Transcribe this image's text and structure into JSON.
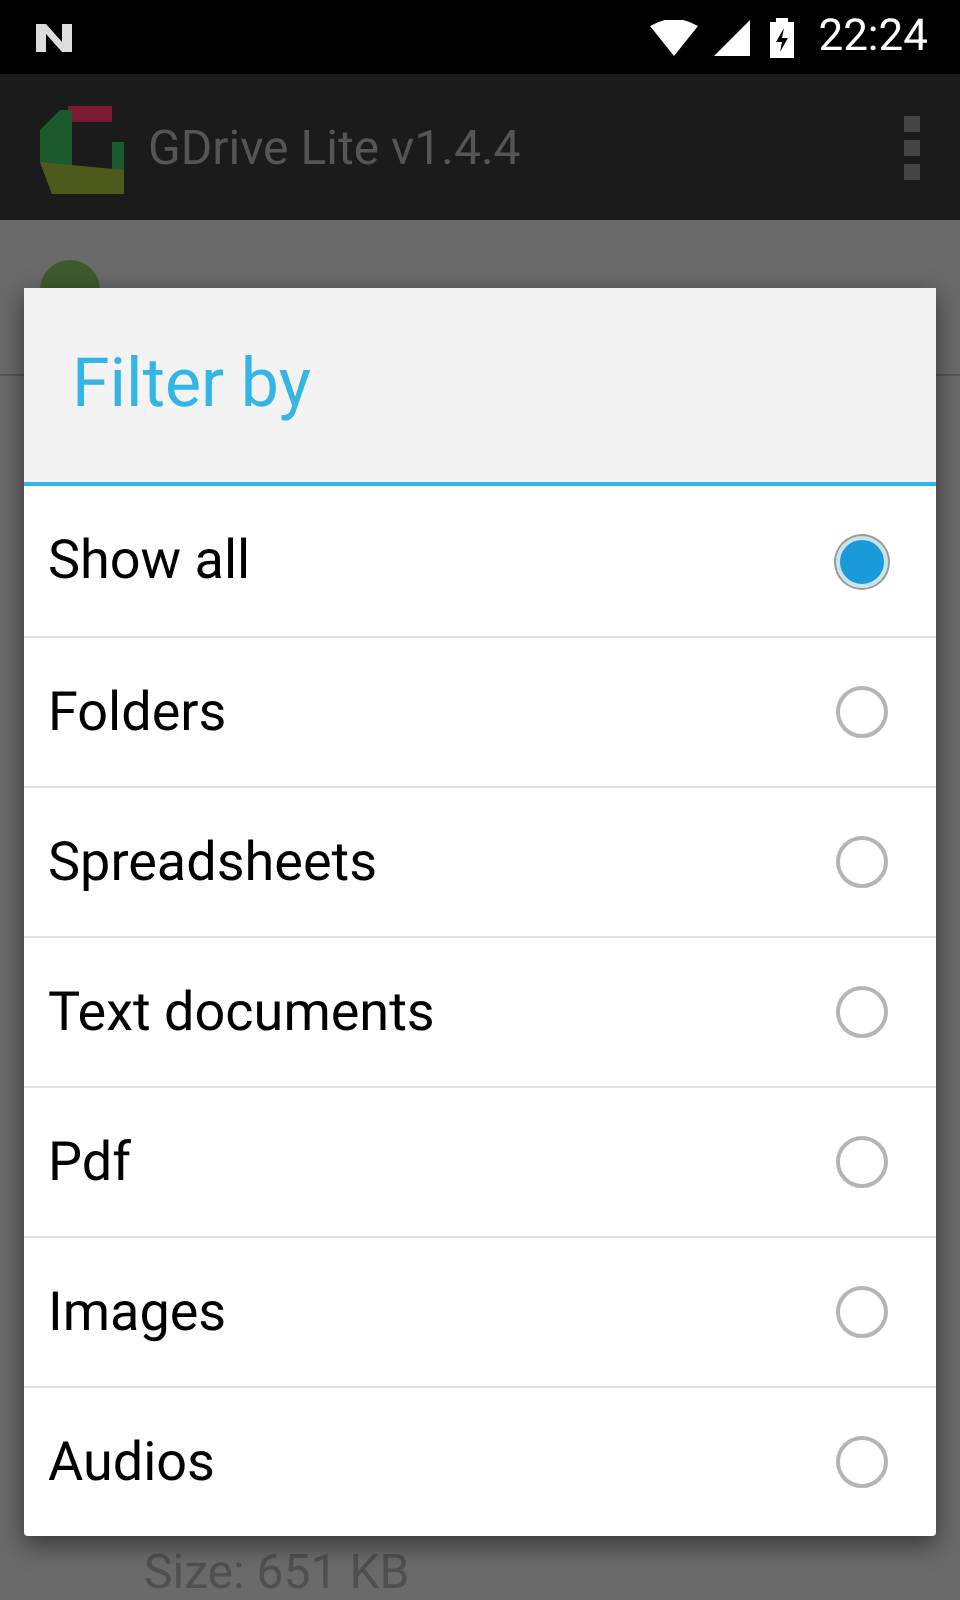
{
  "status_bar": {
    "time": "22:24"
  },
  "app_bar": {
    "title": "GDrive Lite v1.4.4"
  },
  "background_list": {
    "size_text": "Size: 651 KB"
  },
  "dialog": {
    "title": "Filter by",
    "options": [
      {
        "label": "Show all",
        "selected": true
      },
      {
        "label": "Folders",
        "selected": false
      },
      {
        "label": "Spreadsheets",
        "selected": false
      },
      {
        "label": "Text documents",
        "selected": false
      },
      {
        "label": "Pdf",
        "selected": false
      },
      {
        "label": "Images",
        "selected": false
      },
      {
        "label": "Audios",
        "selected": false
      }
    ]
  }
}
